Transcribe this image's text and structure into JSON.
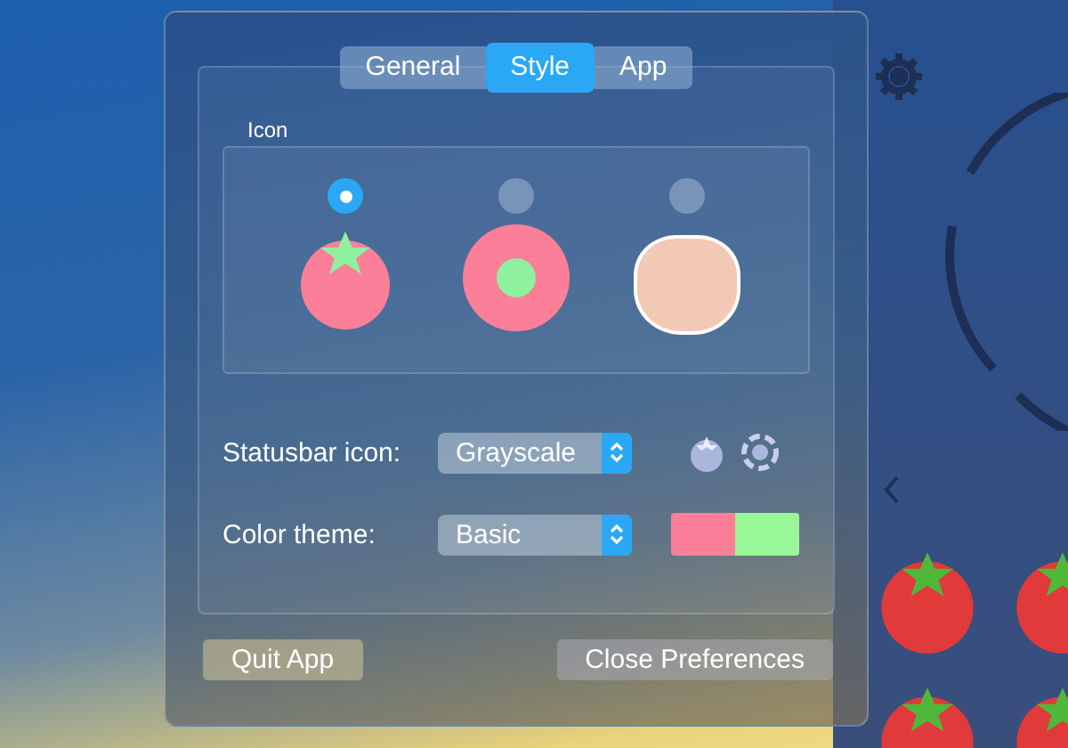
{
  "preferences": {
    "tabs": [
      {
        "label": "General",
        "selected": false
      },
      {
        "label": "Style",
        "selected": true
      },
      {
        "label": "App",
        "selected": false
      }
    ],
    "icon_section": {
      "title": "Icon",
      "options": [
        {
          "kind": "tomato",
          "selected": true
        },
        {
          "kind": "ring",
          "selected": false
        },
        {
          "kind": "sticker",
          "selected": false
        }
      ]
    },
    "statusbar_icon": {
      "label": "Statusbar icon:",
      "value": "Grayscale"
    },
    "color_theme": {
      "label": "Color theme:",
      "value": "Basic",
      "swatches": [
        {
          "color": "#fb7f98"
        },
        {
          "color": "#98f898"
        }
      ]
    },
    "buttons": [
      {
        "label": "Quit App",
        "kind": "quit"
      },
      {
        "label": "Close Preferences",
        "kind": "close"
      }
    ]
  }
}
